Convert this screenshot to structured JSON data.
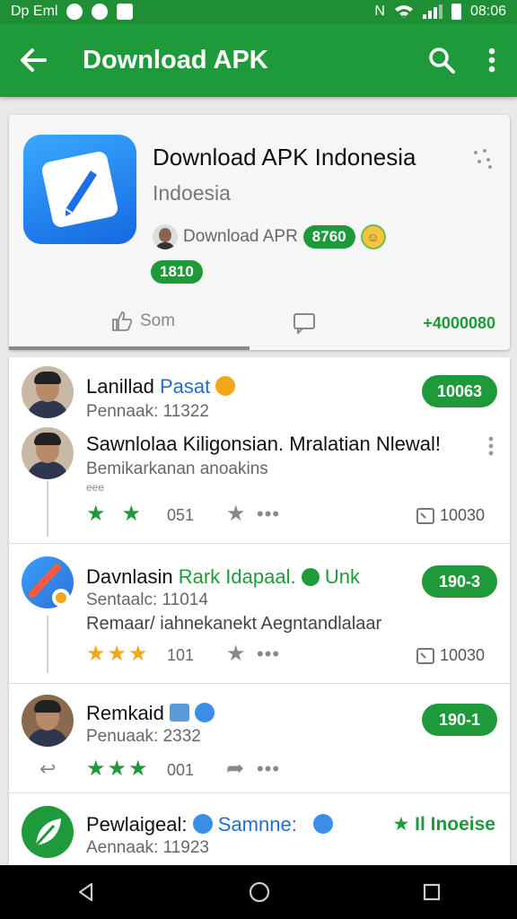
{
  "status_bar": {
    "left_text": "Dp Eml",
    "network": "N",
    "time": "08:06"
  },
  "appbar": {
    "title": "Download APK"
  },
  "header": {
    "app_name": "Download APK Indonesia",
    "subtitle": "Indoesia",
    "developer": "Download APR",
    "rating_pill": "8760",
    "second_pill": "1810",
    "like_label": "Som",
    "count": "+4000080"
  },
  "list": {
    "item1": {
      "name": "Lanillad",
      "tag": "Pasat",
      "sub": "Pennaak: 11322",
      "badge": "10063"
    },
    "item2": {
      "title": "Sawnlolaa Kiligonsian. Mralatian Nlewal!",
      "sub": "Bemikarkanan anoakins",
      "tiny": "eee",
      "count": "051",
      "reply": "10030"
    },
    "item3": {
      "name": "Davnlasin",
      "tag": "Rark Idapaal.",
      "tag2": "Unk",
      "sub": "Sentaalc: 11014",
      "text": "Remaar/ iahnekanekt Aegntandlalaar",
      "badge": "190-3",
      "count": "101",
      "reply": "10030"
    },
    "item4": {
      "name": "Remkaid",
      "sub": "Penuaak: 2332",
      "badge": "190-1",
      "count": "001"
    },
    "item5": {
      "name": "Pewlaigeal:",
      "tag": "Samnne:",
      "right": "Il Inoeise",
      "sub": "Aennaak: 11923"
    }
  },
  "colors": {
    "primary": "#1e9a3a",
    "status": "#1e8f34",
    "star_green": "#1e9a3a",
    "star_gold": "#f2a81d"
  }
}
